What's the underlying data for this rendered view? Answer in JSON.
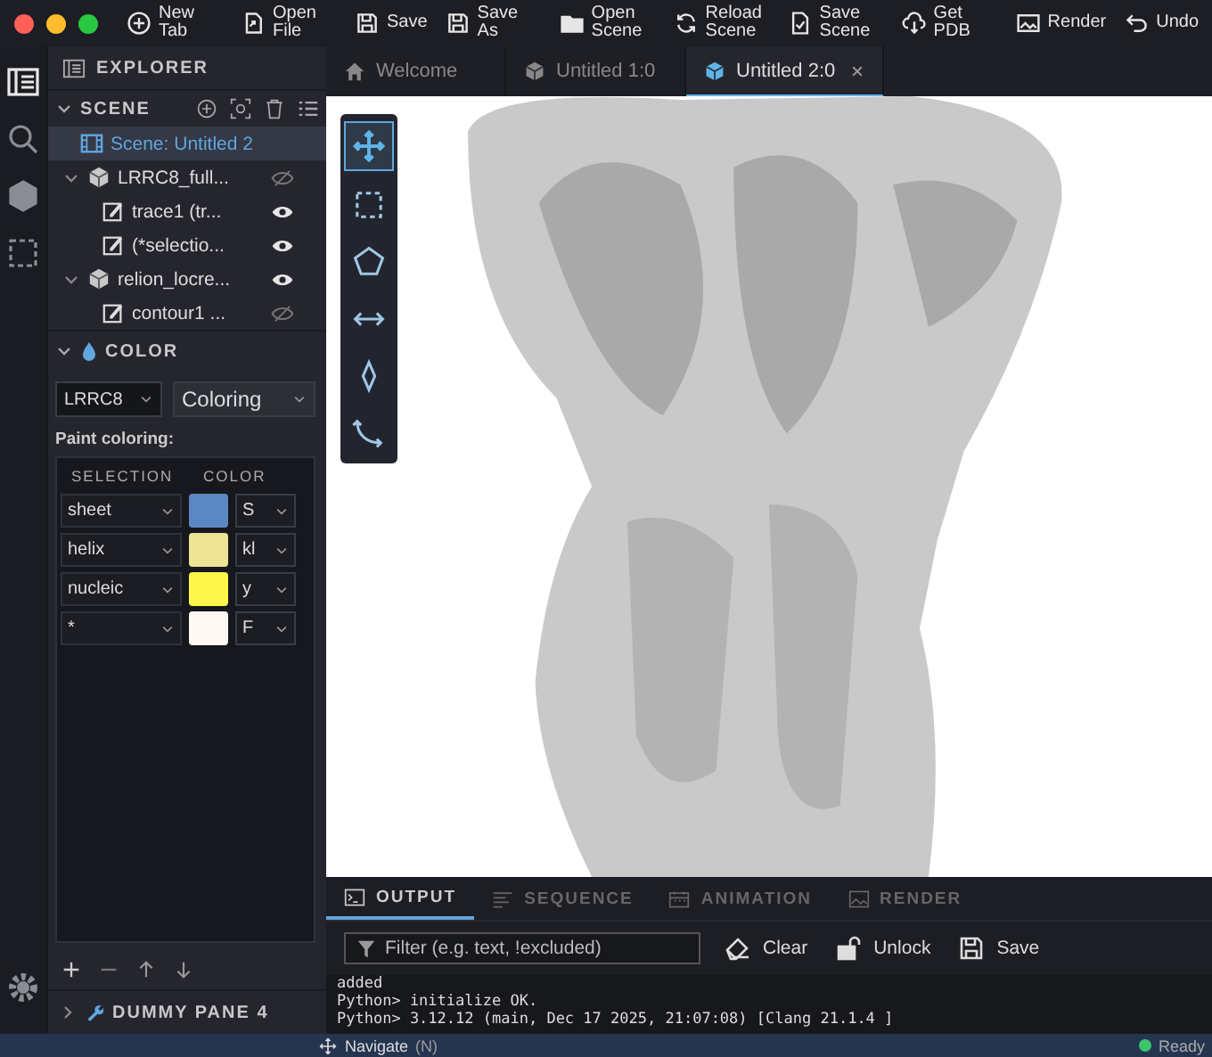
{
  "toolbar": {
    "buttons": [
      {
        "kind": "plus",
        "label": "New Tab"
      },
      {
        "kind": "file",
        "label": "Open File"
      },
      {
        "kind": "save",
        "label": "Save"
      },
      {
        "kind": "save",
        "label": "Save As"
      },
      {
        "kind": "folder",
        "label": "Open Scene"
      },
      {
        "kind": "reload",
        "label": "Reload Scene"
      },
      {
        "kind": "doc",
        "label": "Save Scene"
      },
      {
        "kind": "cloud",
        "label": "Get PDB"
      },
      {
        "kind": "image",
        "label": "Render"
      },
      {
        "kind": "undo",
        "label": "Undo"
      }
    ]
  },
  "activity_bar": {
    "items": [
      {
        "kind": "explorer",
        "selected": true
      },
      {
        "kind": "search",
        "selected": false
      },
      {
        "kind": "cube",
        "selected": false
      },
      {
        "kind": "select",
        "selected": false
      }
    ]
  },
  "explorer": {
    "title": "EXPLORER",
    "scene": {
      "title": "SCENE",
      "tree": [
        {
          "label": "Scene: Untitled 2",
          "kind": "scene",
          "selected": true,
          "children": [
            {
              "label": "LRRC8_full...",
              "kind": "model",
              "expanded": true,
              "visible": false,
              "selected": false,
              "children": [
                {
                  "label": "trace1 (tr...",
                  "kind": "item",
                  "visible": true,
                  "selected": false
                },
                {
                  "label": "(*selectio...",
                  "kind": "item",
                  "visible": true,
                  "selected": false
                }
              ]
            },
            {
              "label": "relion_locre...",
              "kind": "model",
              "expanded": true,
              "visible": true,
              "selected": false,
              "children": [
                {
                  "label": "contour1 ...",
                  "kind": "item",
                  "visible": false,
                  "selected": false
                }
              ]
            }
          ]
        }
      ]
    },
    "color": {
      "title": "COLOR",
      "target": "LRRC8",
      "mode": "Coloring",
      "paint_label": "Paint coloring:",
      "columns": [
        "SELECTION",
        "COLOR"
      ],
      "rows": [
        {
          "selection": "sheet",
          "color": "#5b88c2",
          "name": "S"
        },
        {
          "selection": "helix",
          "color": "#ede395",
          "name": "kl"
        },
        {
          "selection": "nucleic",
          "color": "#fdf84a",
          "name": "y"
        },
        {
          "selection": "*",
          "color": "#fdf8f2",
          "name": "F"
        }
      ]
    },
    "dummy_pane": "DUMMY PANE 4"
  },
  "tabs": [
    {
      "label": "Welcome",
      "kind": "home",
      "selected": false
    },
    {
      "label": "Untitled 1:0",
      "kind": "cube",
      "selected": false
    },
    {
      "label": "Untitled 2:0",
      "kind": "cube",
      "selected": true
    }
  ],
  "viewport_tools": [
    {
      "kind": "move",
      "selected": true
    },
    {
      "kind": "rect",
      "selected": false
    },
    {
      "kind": "pentagon",
      "selected": false
    },
    {
      "kind": "distance",
      "selected": false
    },
    {
      "kind": "diamond",
      "selected": false
    },
    {
      "kind": "rotate",
      "selected": false
    }
  ],
  "panel": {
    "tabs": [
      {
        "label": "OUTPUT",
        "kind": "terminal",
        "selected": true
      },
      {
        "label": "SEQUENCE",
        "kind": "lines",
        "selected": false
      },
      {
        "label": "ANIMATION",
        "kind": "calendar",
        "selected": false
      },
      {
        "label": "RENDER",
        "kind": "image",
        "selected": false
      }
    ],
    "filter": {
      "placeholder": "Filter (e.g. text, !excluded)"
    },
    "actions": [
      {
        "kind": "eraser",
        "label": "Clear"
      },
      {
        "kind": "lock",
        "label": "Unlock"
      },
      {
        "kind": "save",
        "label": "Save"
      }
    ],
    "console": [
      "added",
      "Python> initialize OK.",
      "Python> 3.12.12 (main, Dec 17 2025, 21:07:08) [Clang 21.1.4 ]"
    ]
  },
  "status_bar": {
    "mode": "Navigate",
    "shortcut": "(N)",
    "status": "Ready"
  }
}
